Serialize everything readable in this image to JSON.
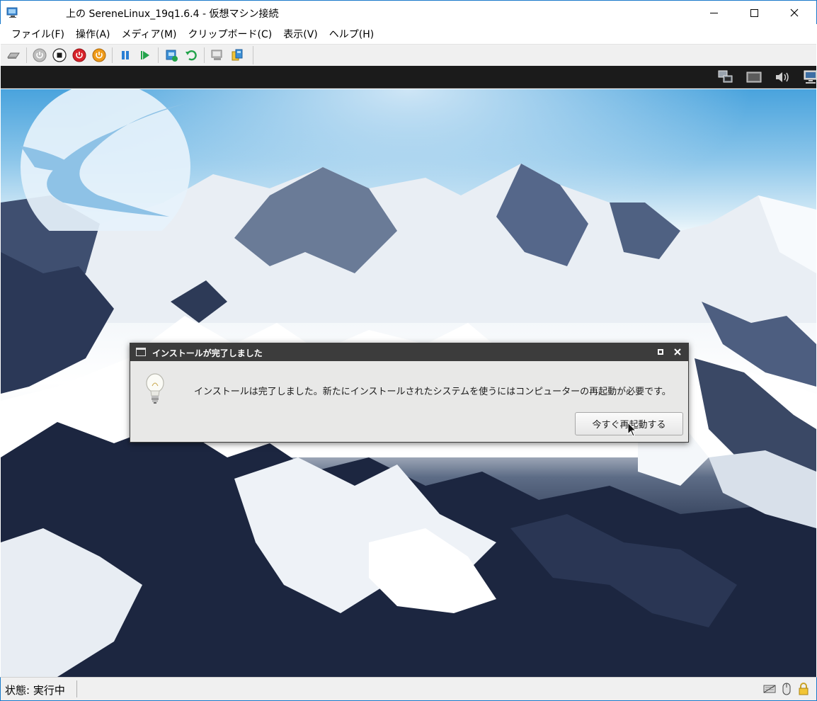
{
  "window": {
    "title": "上の SereneLinux_19q1.6.4  - 仮想マシン接続",
    "app_icon": "vm-connection-icon",
    "controls": [
      "minimize-icon",
      "maximize-icon",
      "close-icon"
    ]
  },
  "menubar": {
    "items": [
      {
        "label": "ファイル(F)"
      },
      {
        "label": "操作(A)"
      },
      {
        "label": "メディア(M)"
      },
      {
        "label": "クリップボード(C)"
      },
      {
        "label": "表示(V)"
      },
      {
        "label": "ヘルプ(H)"
      }
    ]
  },
  "toolbar": {
    "buttons": [
      {
        "icon": "ctrl-alt-del-icon"
      },
      {
        "icon": "start-icon"
      },
      {
        "icon": "turn-off-icon"
      },
      {
        "icon": "shutdown-icon"
      },
      {
        "icon": "save-icon"
      },
      {
        "icon": "pause-icon"
      },
      {
        "icon": "resume-icon"
      },
      {
        "icon": "checkpoint-icon"
      },
      {
        "icon": "revert-icon"
      },
      {
        "icon": "enhanced-session-icon"
      },
      {
        "icon": "share-icon"
      }
    ]
  },
  "vm_panel": {
    "tray_icons": [
      "network-icon",
      "display-icon",
      "volume-icon",
      "monitor-icon"
    ]
  },
  "dialog": {
    "title": "インストールが完了しました",
    "message": "インストールは完了しました。新たにインストールされたシステムを使うにはコンピューターの再起動が必要です。",
    "button_label": "今すぐ再起動する",
    "icon": "lightbulb-icon"
  },
  "statusbar": {
    "status": "状態: 実行中",
    "icons": [
      "keyboard-icon",
      "mouse-icon",
      "lock-icon"
    ]
  },
  "colors": {
    "window_border": "#1979ca",
    "vm_panel_bg": "#1b1b1b",
    "dialog_title_bg": "#3c3c3c",
    "dialog_body_bg": "#e8e8e7"
  }
}
